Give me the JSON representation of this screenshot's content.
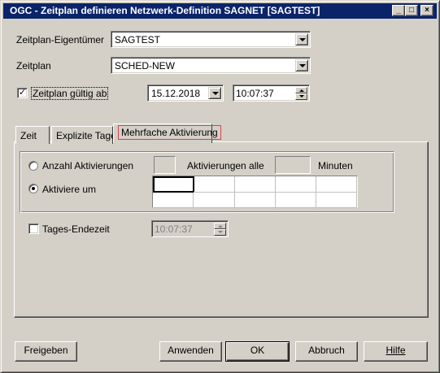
{
  "window": {
    "title": "OGC - Zeitplan definieren Netzwerk-Definition SAGNET [SAGTEST]",
    "controls": {
      "minimize": "_",
      "maximize": "□",
      "close": "×"
    }
  },
  "form": {
    "owner_label": "Zeitplan-Eigentümer",
    "owner_value": "SAGTEST",
    "schedule_label": "Zeitplan",
    "schedule_value": "SCHED-NEW",
    "valid_from_label": "Zeitplan gültig ab",
    "valid_from_checked": true,
    "valid_from_date": "15.12.2018",
    "valid_from_time": "10:07:37"
  },
  "tabs": [
    {
      "label": "Zeit",
      "active": false
    },
    {
      "label": "Explizite Tage",
      "active": false
    },
    {
      "label": "Mehrfache Aktivierung",
      "active": true
    }
  ],
  "activation": {
    "count_label": "Anzahl Aktivierungen",
    "count_selected": false,
    "every_label": "Aktivierungen alle",
    "minutes_label": "Minuten",
    "at_label": "Aktiviere um",
    "at_selected": true,
    "end_time_label": "Tages-Endezeit",
    "end_time_checked": false,
    "end_time_value": "10:07:37"
  },
  "buttons": {
    "release": "Freigeben",
    "apply": "Anwenden",
    "ok": "OK",
    "cancel": "Abbruch",
    "help": "Hilfe"
  },
  "colors": {
    "titlebar": "#0a246a",
    "face": "#d4d0c8",
    "focus_tab_border": "#e04040"
  }
}
